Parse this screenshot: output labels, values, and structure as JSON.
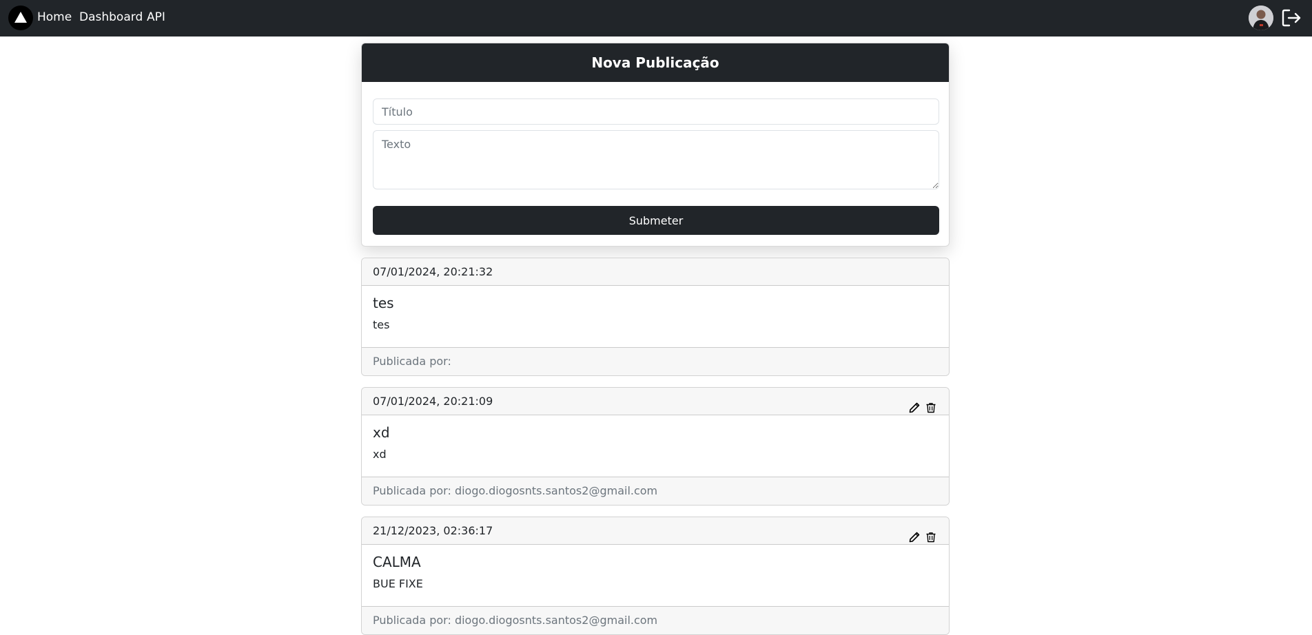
{
  "navbar": {
    "links": [
      {
        "label": "Home"
      },
      {
        "label": "Dashboard"
      },
      {
        "label": "API"
      }
    ]
  },
  "form": {
    "header": "Nova Publicação",
    "title_placeholder": "Título",
    "text_placeholder": "Texto",
    "title_value": "",
    "text_value": "",
    "submit_label": "Submeter"
  },
  "posts": [
    {
      "date": "07/01/2024, 20:21:32",
      "title": "tes",
      "text": "tes",
      "author_prefix": "Publicada por:",
      "author": "",
      "actions": false
    },
    {
      "date": "07/01/2024, 20:21:09",
      "title": "xd",
      "text": "xd",
      "author_prefix": "Publicada por:",
      "author": "diogo.diogosnts.santos2@gmail.com",
      "actions": true
    },
    {
      "date": "21/12/2023, 02:36:17",
      "title": "CALMA",
      "text": "BUE FIXE",
      "author_prefix": "Publicada por:",
      "author": "diogo.diogosnts.santos2@gmail.com",
      "actions": true
    }
  ],
  "icons": {
    "brand": "triangle-logo-icon",
    "avatar": "user-avatar",
    "logout": "logout-icon",
    "edit": "pencil-icon",
    "delete": "trash-icon"
  },
  "colors": {
    "navbar_bg": "#212529",
    "card_header_bg": "#f7f7f7",
    "muted_text": "#6c757d"
  }
}
